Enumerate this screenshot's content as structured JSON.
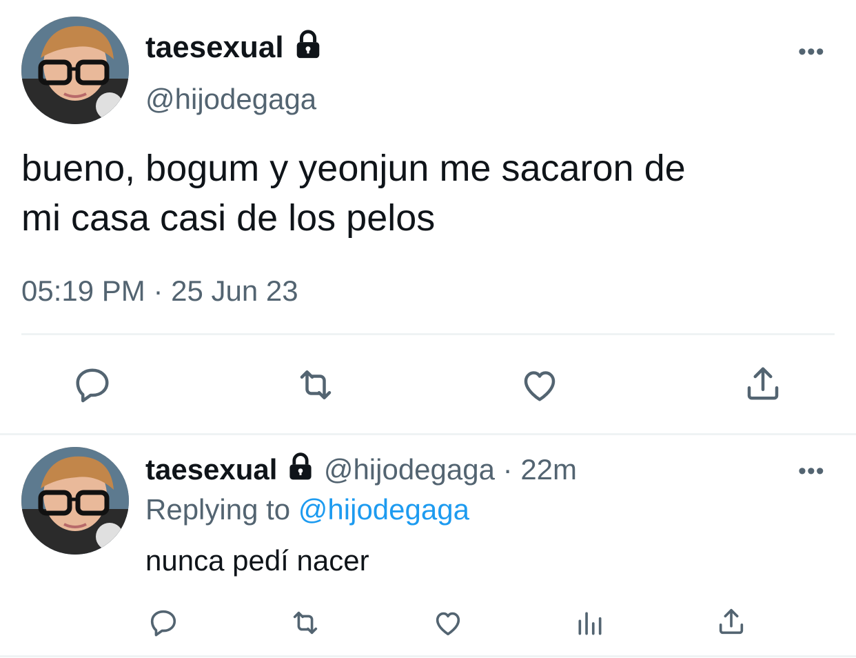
{
  "main_tweet": {
    "display_name": "taesexual",
    "handle": "@hijodegaga",
    "text_line1": "bueno, bogum y yeonjun me sacaron de",
    "text_line2": "mi casa casi de los pelos",
    "time": "05:19 PM",
    "separator": "·",
    "date": "25 Jun 23",
    "more_label": "•••",
    "actions": [
      "reply-icon",
      "retweet-icon",
      "like-icon",
      "share-icon"
    ]
  },
  "reply_tweet": {
    "display_name": "taesexual",
    "handle": "@hijodegaga",
    "separator": "·",
    "age": "22m",
    "replying_prefix": "Replying to",
    "replying_handle": "@hijodegaga",
    "text": "nunca pedí nacer",
    "more_label": "•••",
    "actions": [
      "reply-icon",
      "retweet-icon",
      "like-icon",
      "views-icon",
      "share-icon"
    ]
  },
  "colors": {
    "text": "#0f1419",
    "secondary": "#536471",
    "accent": "#1d9bf0",
    "divider": "#eff3f4"
  }
}
